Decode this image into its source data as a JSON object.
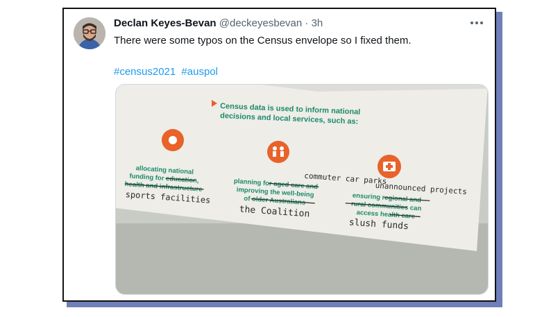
{
  "tweet": {
    "author_name": "Declan Keyes-Bevan",
    "handle": "@deckeyesbevan",
    "separator": "·",
    "time": "3h",
    "text": "There were some typos on the Census envelope so I fixed them.",
    "hashtags": [
      "#census2021",
      "#auspol"
    ]
  },
  "photo": {
    "heading_line1": "Census data is used to inform national",
    "heading_line2": "decisions and local services, such as:",
    "col1": [
      "allocating national",
      "funding for education,",
      "health and infrastructure"
    ],
    "col1_hand": "sports facilities",
    "col2": [
      "planning for aged care and",
      "improving the well-being",
      "of older Australians"
    ],
    "col2_hand_top": "commuter car parks",
    "col2_hand_bottom": "the Coalition",
    "col3": [
      "ensuring regional and",
      "rural communities can",
      "access health care"
    ],
    "col3_hand_top": "unannounced projects",
    "col3_hand_bottom": "slush funds",
    "accent_color": "#1c8a6b",
    "icon_color": "#e8622a"
  },
  "colors": {
    "link": "#1d9bf0",
    "frame_shadow": "#6f7fb8"
  }
}
